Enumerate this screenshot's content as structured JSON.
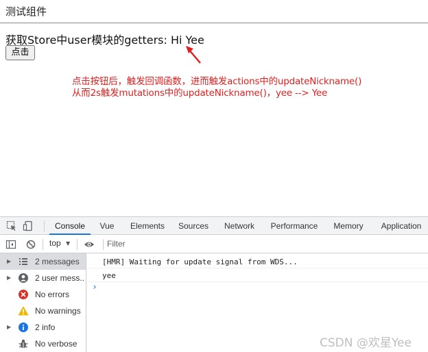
{
  "page": {
    "title": "测试组件",
    "getter_text": "获取Store中user模块的getters: Hi Yee",
    "button_label": "点击",
    "annotation_line1": "点击按钮后，触发回调函数，进而触发actions中的updateNickname()",
    "annotation_line2": "从而2s触发mutations中的updateNickname()，yee --> Yee",
    "annotation_color": "#e02020"
  },
  "devtools": {
    "tabs": [
      {
        "label": "Console",
        "active": true
      },
      {
        "label": "Vue"
      },
      {
        "label": "Elements"
      },
      {
        "label": "Sources"
      },
      {
        "label": "Network"
      },
      {
        "label": "Performance"
      },
      {
        "label": "Memory"
      },
      {
        "label": "Application"
      }
    ],
    "toolbar": {
      "context": "top",
      "filter_placeholder": "Filter"
    },
    "sidebar": [
      {
        "label": "2 messages",
        "icon": "list-icon",
        "selected": true
      },
      {
        "label": "2 user mess...",
        "icon": "user-icon"
      },
      {
        "label": "No errors",
        "icon": "error-icon"
      },
      {
        "label": "No warnings",
        "icon": "warning-icon"
      },
      {
        "label": "2 info",
        "icon": "info-icon"
      },
      {
        "label": "No verbose",
        "icon": "bug-icon"
      }
    ],
    "console_lines": [
      "[HMR] Waiting for update signal from WDS...",
      "yee"
    ],
    "accent_color": "#1a73e8"
  },
  "watermark": "CSDN @欢星Yee"
}
